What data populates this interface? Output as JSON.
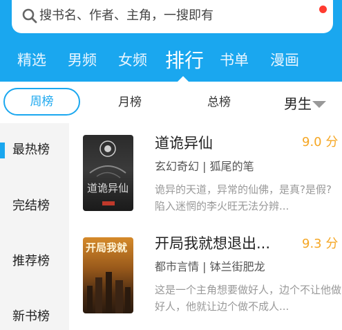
{
  "search": {
    "placeholder": "搜书名、作者、主角，一搜即有"
  },
  "tabs": [
    "精选",
    "男频",
    "女频",
    "排行",
    "书单",
    "漫画"
  ],
  "active_tab": "排行",
  "sub_tabs": [
    "周榜",
    "月榜",
    "总榜"
  ],
  "gender_filter": "男生",
  "sidebar": [
    "最热榜",
    "完结榜",
    "推荐榜",
    "新书榜"
  ],
  "books": [
    {
      "title": "道诡异仙",
      "score": "9.0 分",
      "meta": "玄幻奇幻 | 狐尾的笔",
      "desc": "诡异的天道，异常的仙佛，是真?是假?陷入迷惘的李火旺无法分辨..."
    },
    {
      "title": "开局我就想退出...",
      "score": "9.3 分",
      "meta": "都市言情 | 钵兰街肥龙",
      "desc": "这是一个主角想要做好人，边个不让他做好人，他就让边个做不成人..."
    }
  ],
  "covers": [
    {
      "title_text": "道诡异仙"
    },
    {
      "title_text": "开局我就"
    }
  ]
}
